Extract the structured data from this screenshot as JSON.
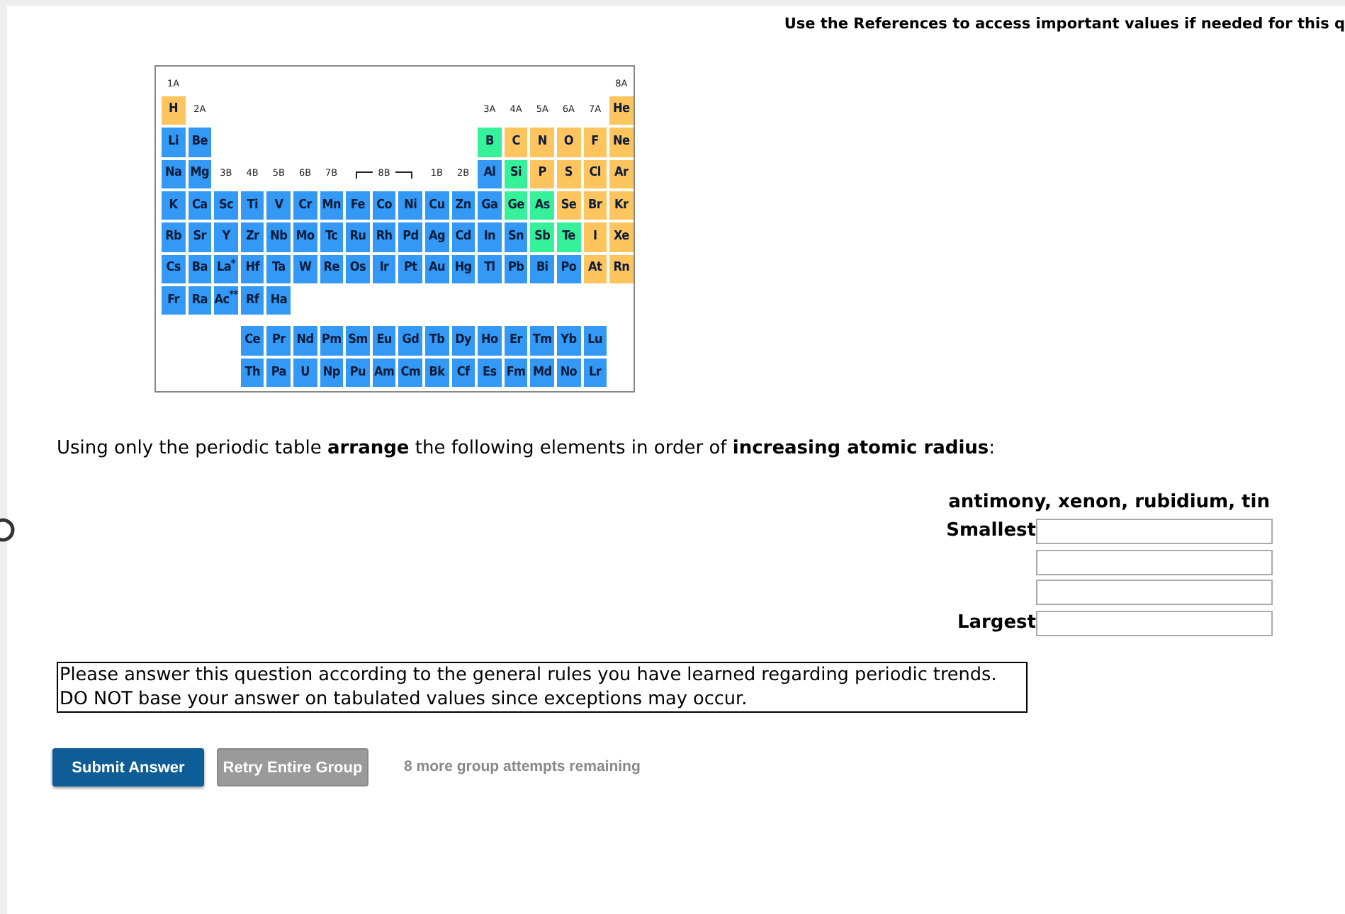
{
  "header_note": "Use the References to access important values if needed for this q",
  "periodic_table": {
    "main_rows": [
      [
        {
          "kind": "label",
          "text": "1A"
        },
        {
          "kind": "blank"
        },
        {
          "kind": "blank"
        },
        {
          "kind": "blank"
        },
        {
          "kind": "blank"
        },
        {
          "kind": "blank"
        },
        {
          "kind": "blank"
        },
        {
          "kind": "blank"
        },
        {
          "kind": "blank"
        },
        {
          "kind": "blank"
        },
        {
          "kind": "blank"
        },
        {
          "kind": "blank"
        },
        {
          "kind": "blank"
        },
        {
          "kind": "blank"
        },
        {
          "kind": "blank"
        },
        {
          "kind": "blank"
        },
        {
          "kind": "blank"
        },
        {
          "kind": "label",
          "text": "8A"
        }
      ],
      [
        {
          "kind": "element",
          "symbol": "H",
          "color": "#fec45e"
        },
        {
          "kind": "label",
          "text": "2A"
        },
        {
          "kind": "blank"
        },
        {
          "kind": "blank"
        },
        {
          "kind": "blank"
        },
        {
          "kind": "blank"
        },
        {
          "kind": "blank"
        },
        {
          "kind": "blank"
        },
        {
          "kind": "blank"
        },
        {
          "kind": "blank"
        },
        {
          "kind": "blank"
        },
        {
          "kind": "blank"
        },
        {
          "kind": "label",
          "text": "3A"
        },
        {
          "kind": "label",
          "text": "4A"
        },
        {
          "kind": "label",
          "text": "5A"
        },
        {
          "kind": "label",
          "text": "6A"
        },
        {
          "kind": "label",
          "text": "7A"
        },
        {
          "kind": "element",
          "symbol": "He",
          "color": "#fec45e"
        }
      ],
      [
        {
          "kind": "element",
          "symbol": "Li",
          "color": "#3399f5"
        },
        {
          "kind": "element",
          "symbol": "Be",
          "color": "#3399f5"
        },
        {
          "kind": "blank"
        },
        {
          "kind": "blank"
        },
        {
          "kind": "blank"
        },
        {
          "kind": "blank"
        },
        {
          "kind": "blank"
        },
        {
          "kind": "blank"
        },
        {
          "kind": "blank"
        },
        {
          "kind": "blank"
        },
        {
          "kind": "blank"
        },
        {
          "kind": "blank"
        },
        {
          "kind": "element",
          "symbol": "B",
          "color": "#36f09a"
        },
        {
          "kind": "element",
          "symbol": "C",
          "color": "#fec45e"
        },
        {
          "kind": "element",
          "symbol": "N",
          "color": "#fec45e"
        },
        {
          "kind": "element",
          "symbol": "O",
          "color": "#fec45e"
        },
        {
          "kind": "element",
          "symbol": "F",
          "color": "#fec45e"
        },
        {
          "kind": "element",
          "symbol": "Ne",
          "color": "#fec45e"
        }
      ],
      [
        {
          "kind": "element",
          "symbol": "Na",
          "color": "#3399f5"
        },
        {
          "kind": "element",
          "symbol": "Mg",
          "color": "#3399f5"
        },
        {
          "kind": "label",
          "text": "3B"
        },
        {
          "kind": "label",
          "text": "4B"
        },
        {
          "kind": "label",
          "text": "5B"
        },
        {
          "kind": "label",
          "text": "6B"
        },
        {
          "kind": "label",
          "text": "7B"
        },
        {
          "kind": "bracket_start"
        },
        {
          "kind": "bracket_label",
          "text": "8B"
        },
        {
          "kind": "bracket_end"
        },
        {
          "kind": "label",
          "text": "1B"
        },
        {
          "kind": "label",
          "text": "2B"
        },
        {
          "kind": "element",
          "symbol": "Al",
          "color": "#3399f5"
        },
        {
          "kind": "element",
          "symbol": "Si",
          "color": "#36f09a"
        },
        {
          "kind": "element",
          "symbol": "P",
          "color": "#fec45e"
        },
        {
          "kind": "element",
          "symbol": "S",
          "color": "#fec45e"
        },
        {
          "kind": "element",
          "symbol": "Cl",
          "color": "#fec45e"
        },
        {
          "kind": "element",
          "symbol": "Ar",
          "color": "#fec45e"
        }
      ],
      [
        {
          "kind": "element",
          "symbol": "K",
          "color": "#3399f5"
        },
        {
          "kind": "element",
          "symbol": "Ca",
          "color": "#3399f5"
        },
        {
          "kind": "element",
          "symbol": "Sc",
          "color": "#3399f5"
        },
        {
          "kind": "element",
          "symbol": "Ti",
          "color": "#3399f5"
        },
        {
          "kind": "element",
          "symbol": "V",
          "color": "#3399f5"
        },
        {
          "kind": "element",
          "symbol": "Cr",
          "color": "#3399f5"
        },
        {
          "kind": "element",
          "symbol": "Mn",
          "color": "#3399f5"
        },
        {
          "kind": "element",
          "symbol": "Fe",
          "color": "#3399f5"
        },
        {
          "kind": "element",
          "symbol": "Co",
          "color": "#3399f5"
        },
        {
          "kind": "element",
          "symbol": "Ni",
          "color": "#3399f5"
        },
        {
          "kind": "element",
          "symbol": "Cu",
          "color": "#3399f5"
        },
        {
          "kind": "element",
          "symbol": "Zn",
          "color": "#3399f5"
        },
        {
          "kind": "element",
          "symbol": "Ga",
          "color": "#3399f5"
        },
        {
          "kind": "element",
          "symbol": "Ge",
          "color": "#36f09a"
        },
        {
          "kind": "element",
          "symbol": "As",
          "color": "#36f09a"
        },
        {
          "kind": "element",
          "symbol": "Se",
          "color": "#fec45e"
        },
        {
          "kind": "element",
          "symbol": "Br",
          "color": "#fec45e"
        },
        {
          "kind": "element",
          "symbol": "Kr",
          "color": "#fec45e"
        }
      ],
      [
        {
          "kind": "element",
          "symbol": "Rb",
          "color": "#3399f5"
        },
        {
          "kind": "element",
          "symbol": "Sr",
          "color": "#3399f5"
        },
        {
          "kind": "element",
          "symbol": "Y",
          "color": "#3399f5"
        },
        {
          "kind": "element",
          "symbol": "Zr",
          "color": "#3399f5"
        },
        {
          "kind": "element",
          "symbol": "Nb",
          "color": "#3399f5"
        },
        {
          "kind": "element",
          "symbol": "Mo",
          "color": "#3399f5"
        },
        {
          "kind": "element",
          "symbol": "Tc",
          "color": "#3399f5"
        },
        {
          "kind": "element",
          "symbol": "Ru",
          "color": "#3399f5"
        },
        {
          "kind": "element",
          "symbol": "Rh",
          "color": "#3399f5"
        },
        {
          "kind": "element",
          "symbol": "Pd",
          "color": "#3399f5"
        },
        {
          "kind": "element",
          "symbol": "Ag",
          "color": "#3399f5"
        },
        {
          "kind": "element",
          "symbol": "Cd",
          "color": "#3399f5"
        },
        {
          "kind": "element",
          "symbol": "In",
          "color": "#3399f5"
        },
        {
          "kind": "element",
          "symbol": "Sn",
          "color": "#3399f5"
        },
        {
          "kind": "element",
          "symbol": "Sb",
          "color": "#36f09a"
        },
        {
          "kind": "element",
          "symbol": "Te",
          "color": "#36f09a"
        },
        {
          "kind": "element",
          "symbol": "I",
          "color": "#fec45e"
        },
        {
          "kind": "element",
          "symbol": "Xe",
          "color": "#fec45e"
        }
      ],
      [
        {
          "kind": "element",
          "symbol": "Cs",
          "color": "#3399f5"
        },
        {
          "kind": "element",
          "symbol": "Ba",
          "color": "#3399f5"
        },
        {
          "kind": "element",
          "symbol": "La$^{*}$",
          "color": "#3399f5"
        },
        {
          "kind": "element",
          "symbol": "Hf",
          "color": "#3399f5"
        },
        {
          "kind": "element",
          "symbol": "Ta",
          "color": "#3399f5"
        },
        {
          "kind": "element",
          "symbol": "W",
          "color": "#3399f5"
        },
        {
          "kind": "element",
          "symbol": "Re",
          "color": "#3399f5"
        },
        {
          "kind": "element",
          "symbol": "Os",
          "color": "#3399f5"
        },
        {
          "kind": "element",
          "symbol": "Ir",
          "color": "#3399f5"
        },
        {
          "kind": "element",
          "symbol": "Pt",
          "color": "#3399f5"
        },
        {
          "kind": "element",
          "symbol": "Au",
          "color": "#3399f5"
        },
        {
          "kind": "element",
          "symbol": "Hg",
          "color": "#3399f5"
        },
        {
          "kind": "element",
          "symbol": "Tl",
          "color": "#3399f5"
        },
        {
          "kind": "element",
          "symbol": "Pb",
          "color": "#3399f5"
        },
        {
          "kind": "element",
          "symbol": "Bi",
          "color": "#3399f5"
        },
        {
          "kind": "element",
          "symbol": "Po",
          "color": "#3399f5"
        },
        {
          "kind": "element",
          "symbol": "At",
          "color": "#fec45e"
        },
        {
          "kind": "element",
          "symbol": "Rn",
          "color": "#fec45e"
        }
      ],
      [
        {
          "kind": "element",
          "symbol": "Fr",
          "color": "#3399f5"
        },
        {
          "kind": "element",
          "symbol": "Ra",
          "color": "#3399f5"
        },
        {
          "kind": "element",
          "symbol": "Ac$^{**}$",
          "color": "#3399f5"
        },
        {
          "kind": "element",
          "symbol": "Rf",
          "color": "#3399f5"
        },
        {
          "kind": "element",
          "symbol": "Ha",
          "color": "#3399f5"
        }
      ]
    ],
    "f_block_rows": [
      [
        {
          "kind": "blank"
        },
        {
          "kind": "blank"
        },
        {
          "kind": "blank"
        },
        {
          "kind": "element",
          "symbol": "Ce",
          "color": "#3399f5"
        },
        {
          "kind": "element",
          "symbol": "Pr",
          "color": "#3399f5"
        },
        {
          "kind": "element",
          "symbol": "Nd",
          "color": "#3399f5"
        },
        {
          "kind": "element",
          "symbol": "Pm",
          "color": "#3399f5"
        },
        {
          "kind": "element",
          "symbol": "Sm",
          "color": "#3399f5"
        },
        {
          "kind": "element",
          "symbol": "Eu",
          "color": "#3399f5"
        },
        {
          "kind": "element",
          "symbol": "Gd",
          "color": "#3399f5"
        },
        {
          "kind": "element",
          "symbol": "Tb",
          "color": "#3399f5"
        },
        {
          "kind": "element",
          "symbol": "Dy",
          "color": "#3399f5"
        },
        {
          "kind": "element",
          "symbol": "Ho",
          "color": "#3399f5"
        },
        {
          "kind": "element",
          "symbol": "Er",
          "color": "#3399f5"
        },
        {
          "kind": "element",
          "symbol": "Tm",
          "color": "#3399f5"
        },
        {
          "kind": "element",
          "symbol": "Yb",
          "color": "#3399f5"
        },
        {
          "kind": "element",
          "symbol": "Lu",
          "color": "#3399f5"
        }
      ],
      [
        {
          "kind": "blank"
        },
        {
          "kind": "blank"
        },
        {
          "kind": "blank"
        },
        {
          "kind": "element",
          "symbol": "Th",
          "color": "#3399f5"
        },
        {
          "kind": "element",
          "symbol": "Pa",
          "color": "#3399f5"
        },
        {
          "kind": "element",
          "symbol": "U",
          "color": "#3399f5"
        },
        {
          "kind": "element",
          "symbol": "Np",
          "color": "#3399f5"
        },
        {
          "kind": "element",
          "symbol": "Pu",
          "color": "#3399f5"
        },
        {
          "kind": "element",
          "symbol": "Am",
          "color": "#3399f5"
        },
        {
          "kind": "element",
          "symbol": "Cm",
          "color": "#3399f5"
        },
        {
          "kind": "element",
          "symbol": "Bk",
          "color": "#3399f5"
        },
        {
          "kind": "element",
          "symbol": "Cf",
          "color": "#3399f5"
        },
        {
          "kind": "element",
          "symbol": "Es",
          "color": "#3399f5"
        },
        {
          "kind": "element",
          "symbol": "Fm",
          "color": "#3399f5"
        },
        {
          "kind": "element",
          "symbol": "Md",
          "color": "#3399f5"
        },
        {
          "kind": "element",
          "symbol": "No",
          "color": "#3399f5"
        },
        {
          "kind": "element",
          "symbol": "Lr",
          "color": "#3399f5"
        }
      ]
    ]
  },
  "question": "Using only the periodic table **arrange** the following elements in order of **increasing atomic radius**:",
  "element_list": "antimony, xenon, rubidium, tin",
  "answer_fields": [
    {
      "kind": "labeled",
      "label": "Smallest"
    },
    {
      "kind": "plain"
    },
    {
      "kind": "plain"
    },
    {
      "kind": "labeled",
      "label": "Largest"
    }
  ],
  "note": [
    "Please answer this question according to the general rules you have learned regarding periodic trends.",
    "DO NOT base your answer on tabulated values since exceptions may occur."
  ],
  "buttons": [
    {
      "label": "Submit Answer",
      "kind": "primary"
    },
    {
      "label": "Retry Entire Group",
      "kind": "secondary"
    }
  ],
  "attempts": "8 more group attempts remaining"
}
